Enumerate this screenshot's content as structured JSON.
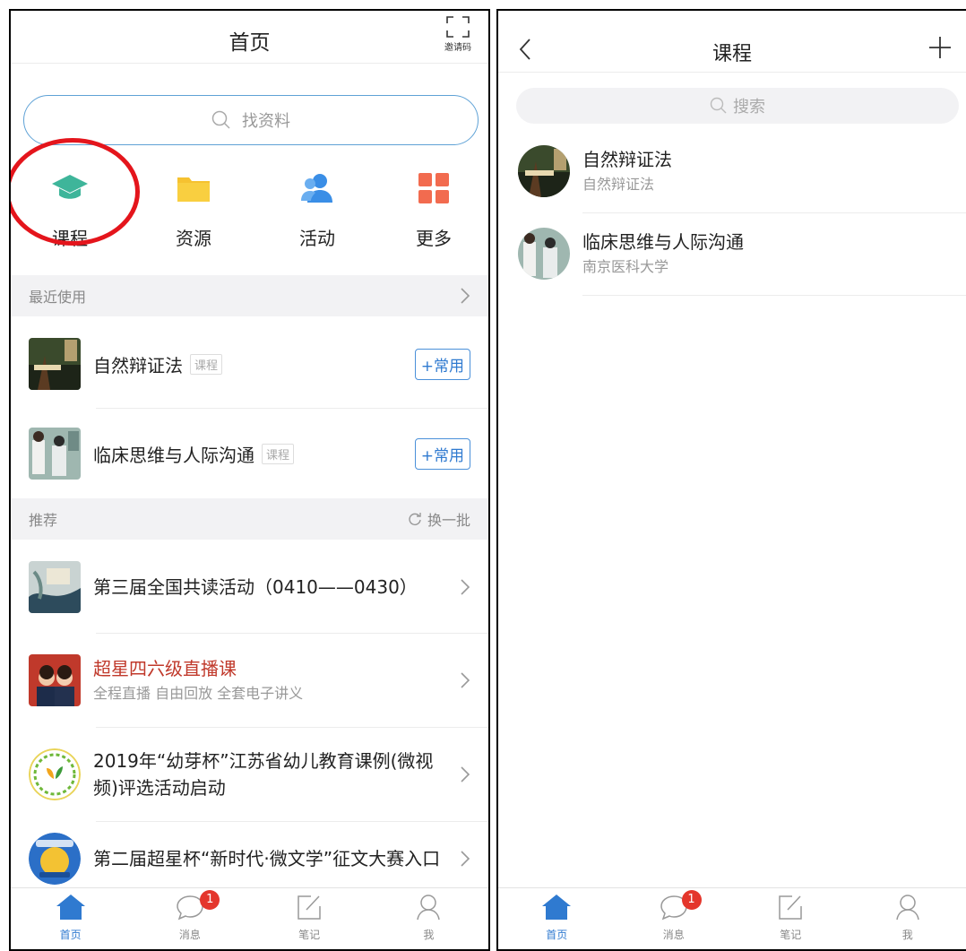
{
  "left": {
    "title": "首页",
    "scan_label": "邀请码",
    "search_placeholder": "找资料",
    "quick": [
      {
        "label": "课程",
        "icon": "graduation-cap-icon"
      },
      {
        "label": "资源",
        "icon": "folder-icon"
      },
      {
        "label": "活动",
        "icon": "people-icon"
      },
      {
        "label": "更多",
        "icon": "grid-icon"
      }
    ],
    "recent_header": "最近使用",
    "recent": [
      {
        "title": "自然辩证法",
        "tag": "课程",
        "button": "+常用"
      },
      {
        "title": "临床思维与人际沟通",
        "tag": "课程",
        "button": "+常用"
      }
    ],
    "recommend_header": "推荐",
    "refresh_label": "换一批",
    "recommend": [
      {
        "title": "第三届全国共读活动（0410——0430）",
        "sub": ""
      },
      {
        "title": "超星四六级直播课",
        "sub": "全程直播   自由回放   全套电子讲义"
      },
      {
        "title": "2019年“幼芽杯”江苏省幼儿教育课例(微视频)评选活动启动",
        "sub": ""
      },
      {
        "title": "第二届超星杯“新时代·微文学”征文大赛入口",
        "sub": ""
      }
    ]
  },
  "right": {
    "title": "课程",
    "search_placeholder": "搜索",
    "courses": [
      {
        "name": "自然辩证法",
        "sub": "自然辩证法"
      },
      {
        "name": "临床思维与人际沟通",
        "sub": "南京医科大学"
      }
    ]
  },
  "tabbar": {
    "tabs": [
      {
        "label": "首页",
        "icon": "home-icon"
      },
      {
        "label": "消息",
        "icon": "message-icon",
        "badge": "1"
      },
      {
        "label": "笔记",
        "icon": "note-icon"
      },
      {
        "label": "我",
        "icon": "user-icon"
      }
    ]
  },
  "colors": {
    "accent": "#2f7ad0",
    "highlight_ring": "#e4151c",
    "badge": "#e4362c",
    "live_title": "#c0392b"
  }
}
